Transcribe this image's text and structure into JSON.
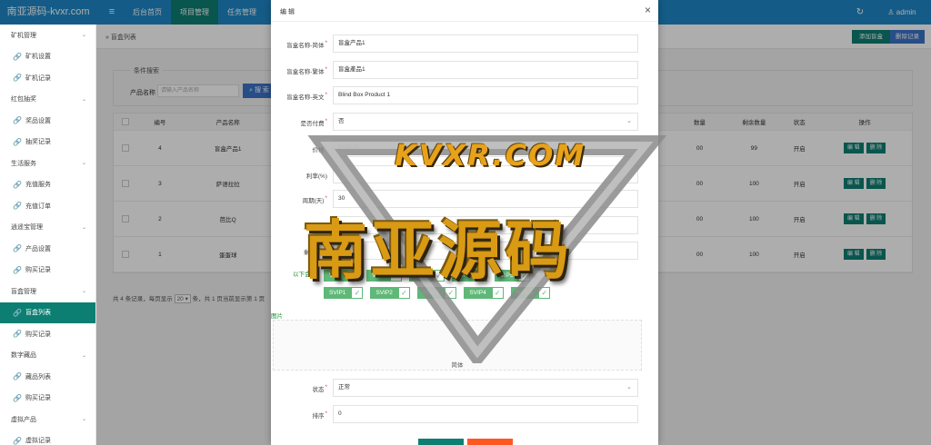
{
  "brand": "南亚源码-kvxr.com",
  "topnav": [
    "后台首页",
    "项目管理",
    "任务管理"
  ],
  "user": "admin",
  "sidebar": [
    {
      "type": "group",
      "label": "矿机管理"
    },
    {
      "type": "sub",
      "label": "矿机设置"
    },
    {
      "type": "sub",
      "label": "矿机记录"
    },
    {
      "type": "group",
      "label": "红包抽奖"
    },
    {
      "type": "sub",
      "label": "奖品设置"
    },
    {
      "type": "sub",
      "label": "抽奖记录"
    },
    {
      "type": "group",
      "label": "生活服务"
    },
    {
      "type": "sub",
      "label": "充值服务"
    },
    {
      "type": "sub",
      "label": "充值订单"
    },
    {
      "type": "group",
      "label": "逍遥宝管理"
    },
    {
      "type": "sub",
      "label": "产品设置"
    },
    {
      "type": "sub",
      "label": "购买记录"
    },
    {
      "type": "group",
      "label": "盲盒管理"
    },
    {
      "type": "sub",
      "label": "盲盒列表",
      "active": true
    },
    {
      "type": "sub",
      "label": "购买记录"
    },
    {
      "type": "group",
      "label": "数字藏品"
    },
    {
      "type": "sub",
      "label": "藏品列表"
    },
    {
      "type": "sub",
      "label": "购买记录"
    },
    {
      "type": "group",
      "label": "虚拟产品"
    },
    {
      "type": "sub",
      "label": "虚拟记录"
    }
  ],
  "main": {
    "breadcrumb": "盲盒列表",
    "add_button": "添加盲盒",
    "delete_button": "删除记录",
    "search_legend": "条件搜索",
    "search_label": "产品名称",
    "search_placeholder": "请输入产品名称",
    "search_button": "搜 索",
    "table_headers": {
      "id": "编号",
      "name": "产品名称",
      "sold": "数量",
      "left": "剩余数量",
      "status": "状态",
      "op": "操作"
    },
    "rows": [
      {
        "id": "4",
        "name": "盲盒产品1",
        "sold": "00",
        "left": "99",
        "status": "开启"
      },
      {
        "id": "3",
        "name": "萨语拉拉",
        "sold": "00",
        "left": "100",
        "status": "开启"
      },
      {
        "id": "2",
        "name": "芭比Q",
        "sold": "00",
        "left": "100",
        "status": "开启"
      },
      {
        "id": "1",
        "name": "蛋蛋球",
        "sold": "00",
        "left": "100",
        "status": "开启"
      }
    ],
    "edit_label": "编 辑",
    "del_label": "删 除",
    "pager_before": "共 4 条记录，每页显示",
    "pager_size": "20",
    "pager_after": "条，共 1 页当前显示第 1 页"
  },
  "modal": {
    "title": "编 辑",
    "fields": [
      {
        "label": "盲盒名称-简体",
        "value": "盲盒产品1",
        "required": true
      },
      {
        "label": "盲盒名称-繁体",
        "value": "盲盒產品1",
        "required": true
      },
      {
        "label": "盲盒名称-英文",
        "value": "Blind Box Product 1",
        "required": true
      },
      {
        "label": "是否付费",
        "value": "否",
        "required": true,
        "select": true
      },
      {
        "label": "价格",
        "value": "1000.00",
        "required": true
      },
      {
        "label": "利率(%)",
        "value": "",
        "required": false
      },
      {
        "label": "周期(天)",
        "value": "30",
        "required": true
      },
      {
        "label": "发放方式",
        "value": "",
        "required": false
      },
      {
        "label": "剩余数量",
        "value": "",
        "required": false
      }
    ],
    "vip_label": "以下会员",
    "vip_row1": [
      "VIP1",
      "VIP2",
      "VIP3",
      "VIP4",
      "VIP5"
    ],
    "vip_row2": [
      "SVIP1",
      "SVIP2",
      "SVIP3",
      "SVIP4",
      "SVIP5"
    ],
    "image_label": "图片",
    "image_caption": "简体",
    "status_field": {
      "label": "状态",
      "value": "正常"
    },
    "sort_field": {
      "label": "排序",
      "value": "0"
    }
  },
  "watermark": {
    "top": "KVXR.COM",
    "main": "南亚源码"
  },
  "colors": {
    "topbar": "#1e88c7",
    "accent": "#0d7f72",
    "blue_button": "#3b73c9",
    "vip_green": "#5fb878"
  }
}
